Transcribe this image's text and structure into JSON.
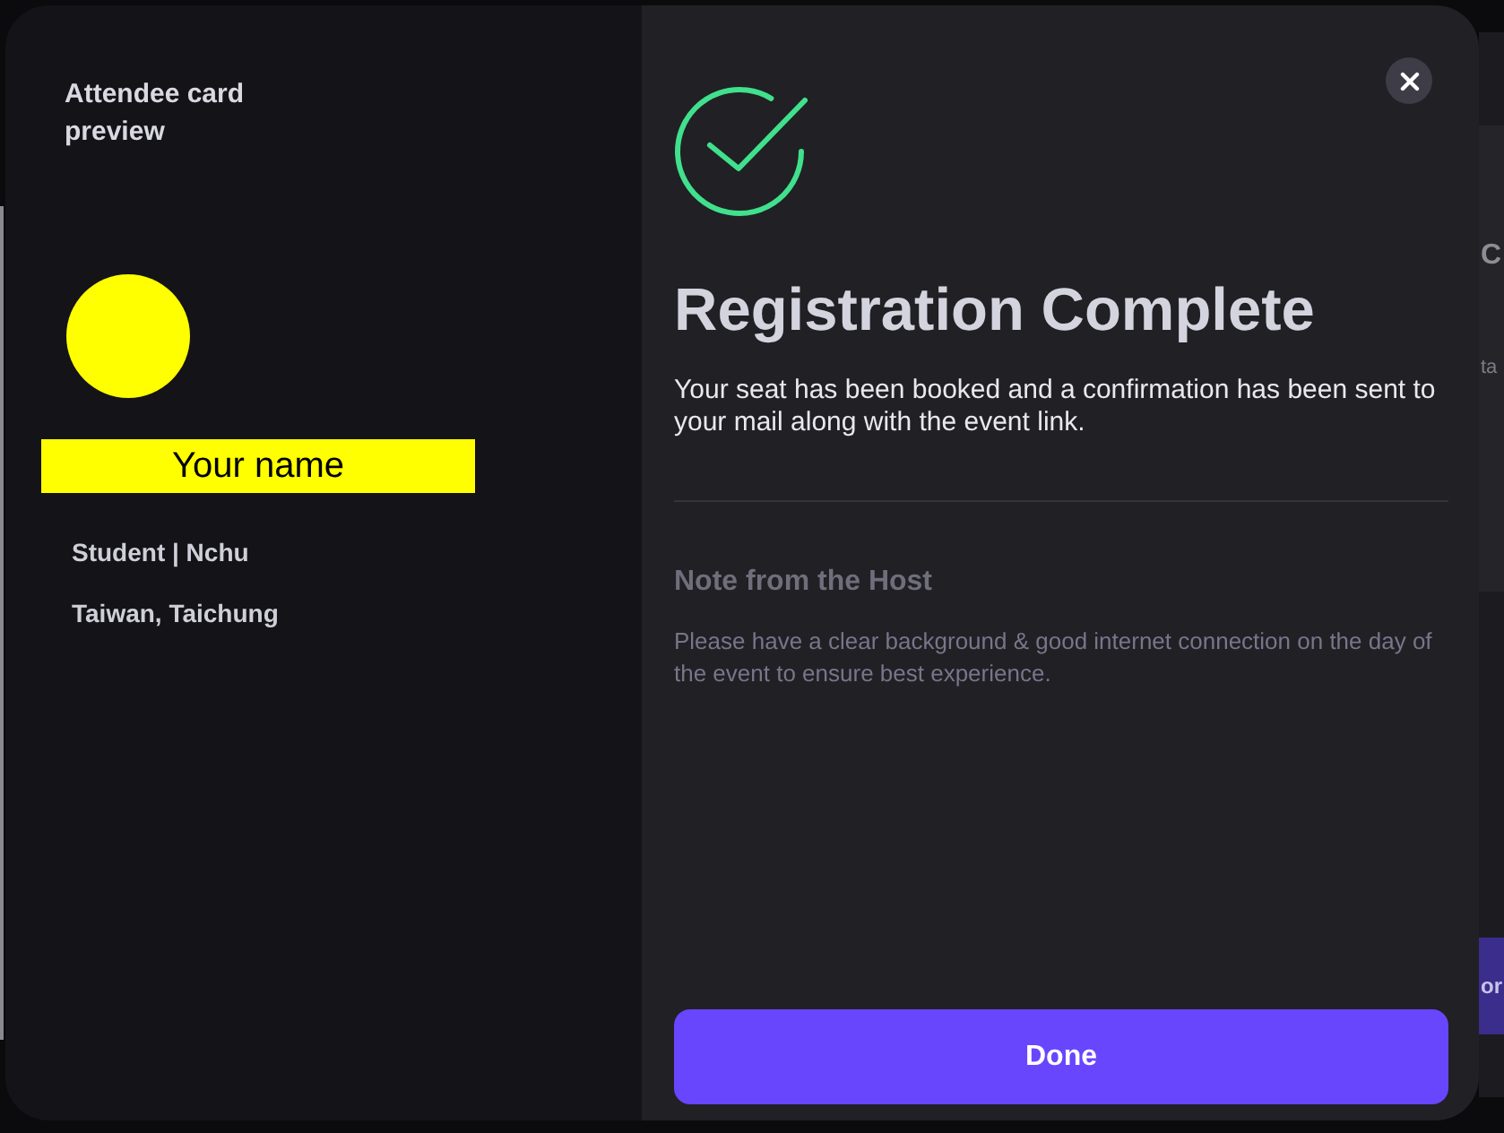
{
  "attendee_card": {
    "title": "Attendee card preview",
    "name": "Your name",
    "details": [
      "Student | Nchu",
      "Taiwan, Taichung"
    ]
  },
  "confirmation": {
    "title": "Registration Complete",
    "message": "Your seat has been booked and a confirmation has been sent to your mail along with the event link.",
    "note_title": "Note from the Host",
    "note": "Please have a clear background & good internet connection on the day of the event to ensure best experience.",
    "button": "Done"
  },
  "backdrop": {
    "heading": "C",
    "text": "ta",
    "button": "or"
  }
}
